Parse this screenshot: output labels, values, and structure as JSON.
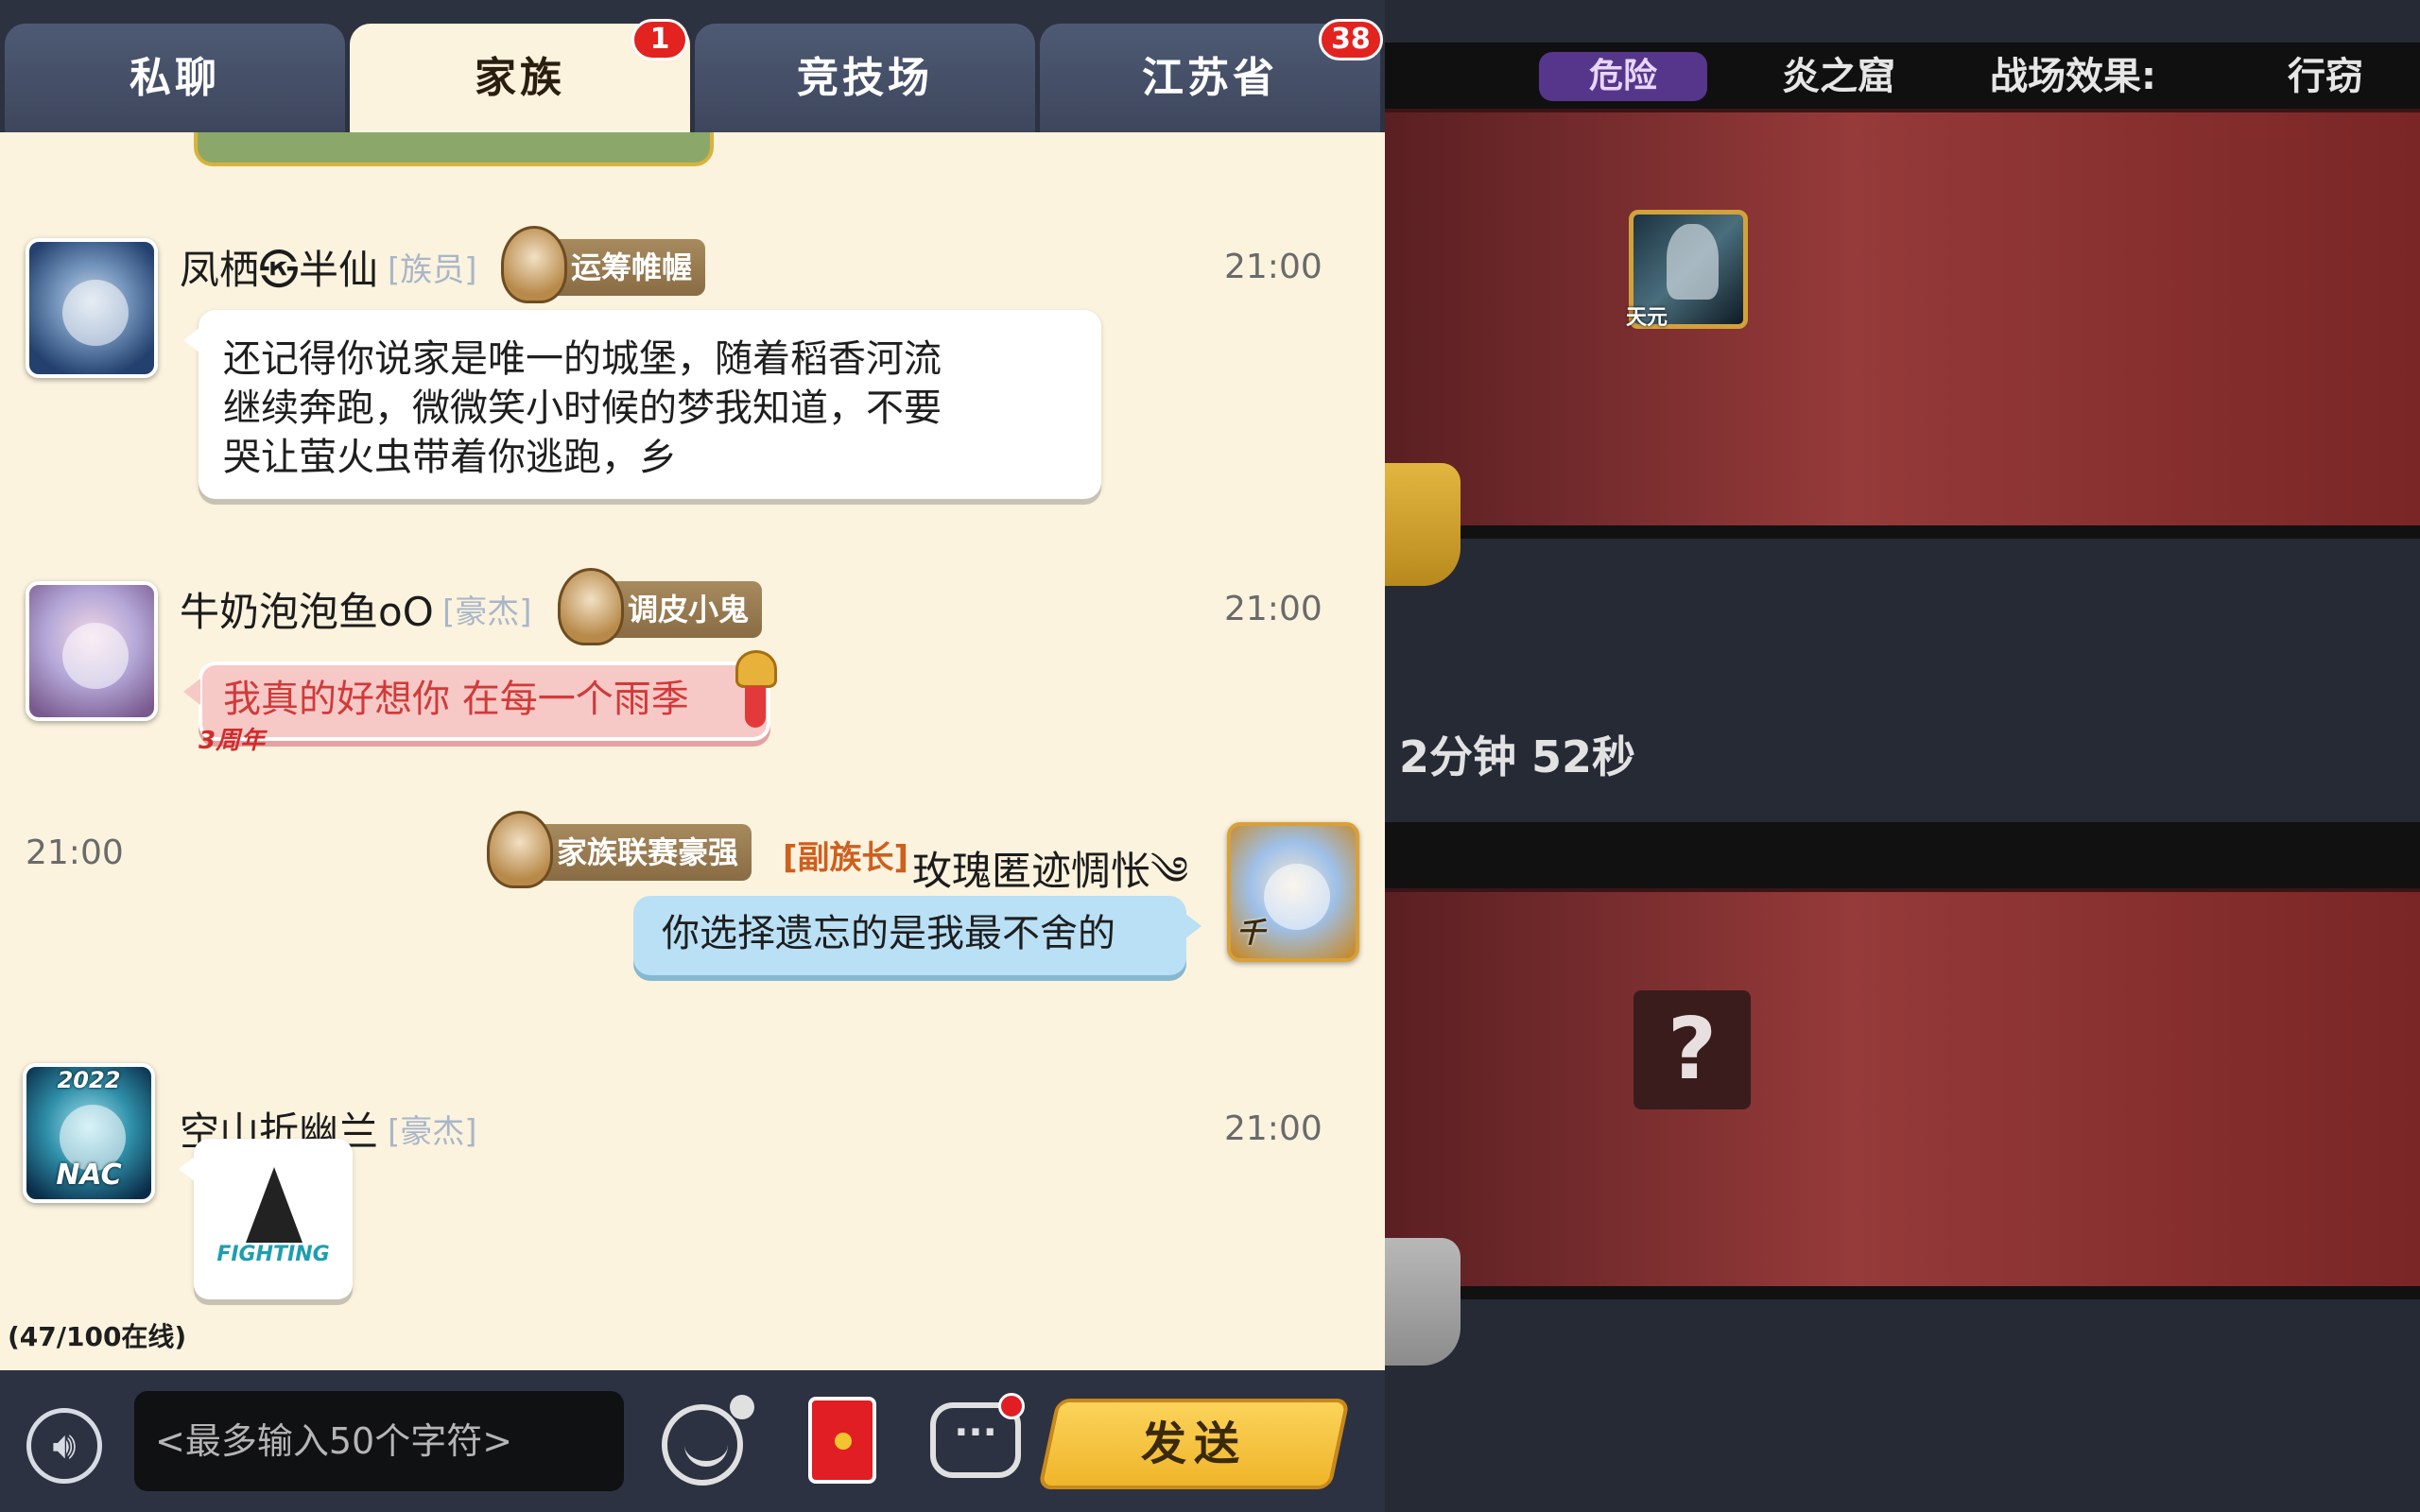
{
  "tabs": [
    {
      "label": "私聊",
      "active": false
    },
    {
      "label": "家族",
      "active": true,
      "badge": "1"
    },
    {
      "label": "竞技场",
      "active": false
    },
    {
      "label": "江苏省",
      "active": false,
      "badge": "38"
    }
  ],
  "messages": [
    {
      "sender": "凤栖㉿半仙",
      "rank": "[族员]",
      "title": "运筹帷幄",
      "time": "21:00",
      "text_lines": [
        "还记得你说家是唯一的城堡，随着稻香河流",
        "继续奔跑，微微笑小时候的梦我知道，不要",
        "哭让萤火虫带着你逃跑，乡"
      ]
    },
    {
      "sender": "牛奶泡泡鱼oO",
      "rank": "[豪杰]",
      "title": "调皮小鬼",
      "time": "21:00",
      "text": "我真的好想你 在每一个雨季",
      "bubble_tag": "3周年"
    },
    {
      "sender": "玫瑰匿迹惆怅༄",
      "rank": "[副族长]",
      "title": "家族联赛豪强",
      "time": "21:00",
      "text": "你选择遗忘的是我最不舍的",
      "avatar_tag": "千"
    },
    {
      "sender": "空山折幽兰",
      "rank": "[豪杰]",
      "time": "21:00",
      "avatar_year": "2022",
      "avatar_tag": "NAC",
      "sticker_text": "FIGHTING"
    }
  ],
  "online_status": "(47/100在线)",
  "input": {
    "placeholder": "<最多输入50个字符>"
  },
  "send_label": "发送",
  "icons": {
    "voice": "voice-icon",
    "emoji": "emoji-icon",
    "red_packet": "red-packet-icon",
    "chat_list": "chat-bubble-icon"
  },
  "game": {
    "danger_tag": "危险",
    "stage_name": "炎之窟",
    "battlefield_effect": "战场效果:",
    "effect_value": "行窃",
    "hero_tag": "天元",
    "timer": "2分钟 52秒",
    "mystery_symbol": "?"
  },
  "colors": {
    "chat_background": "#fbf3de",
    "tab_inactive": "#4e5a74",
    "badge_red": "#e2231f",
    "rank_gray": "#a9b6c8",
    "rank_orange": "#cf5f1e",
    "send_button": "#f0b52a",
    "game_panel_red": "#963a3a",
    "danger_purple": "#56368a"
  }
}
